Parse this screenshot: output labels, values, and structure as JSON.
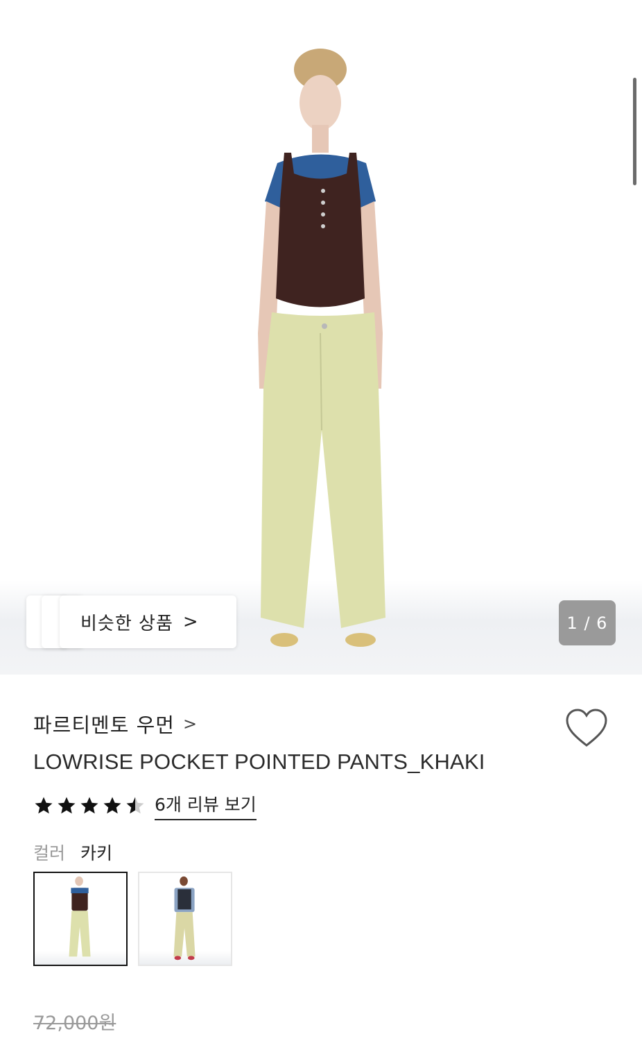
{
  "gallery": {
    "similar_label": "비슷한 상품",
    "chevron": ">",
    "counter": "1 / 6"
  },
  "product": {
    "brand": "파르티멘토 우먼",
    "brand_chevron": ">",
    "title": "LOWRISE POCKET POINTED PANTS_KHAKI",
    "rating": 4.5,
    "review_link": "6개 리뷰 보기",
    "color_label": "컬러",
    "color_value": "카키",
    "original_price": "72,000원"
  },
  "colors": {
    "accent": "#222222",
    "counter_bg": "#9a9a9a",
    "muted": "#999999"
  },
  "icons": [
    "heart-icon",
    "star-icon",
    "chevron-right-icon"
  ]
}
